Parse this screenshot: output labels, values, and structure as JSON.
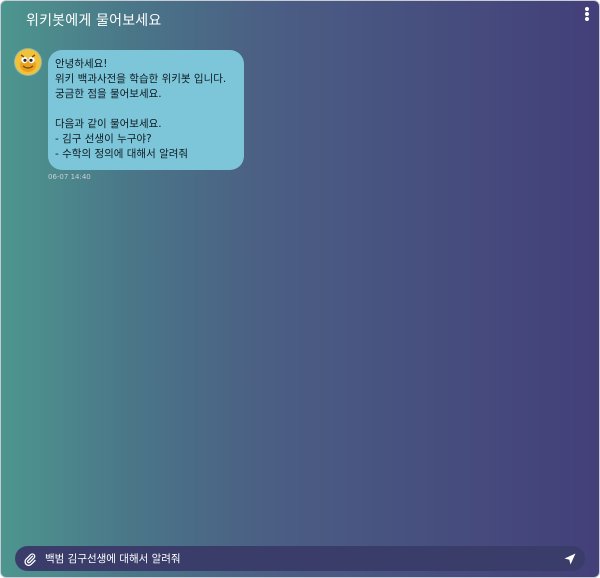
{
  "header": {
    "title": "위키봇에게 물어보세요"
  },
  "conversation": {
    "messages": [
      {
        "sender_avatar": "bot-avatar-icon",
        "lines": [
          "안녕하세요!",
          "위키 백과사전을 학습한 위키봇 입니다.",
          "궁금한 점을 물어보세요.",
          "",
          "다음과 같이 물어보세요.",
          "- 김구 선생이 누구야?",
          "- 수학의 정의에 대해서 알려줘"
        ],
        "time": "06-07 14:40"
      }
    ]
  },
  "composer": {
    "value": "백범 김구선생에 대해서 알려줘",
    "attach_icon": "paperclip-icon",
    "send_icon": "send-icon"
  },
  "colors": {
    "bubble": "#7dc6d9",
    "input_bar": "#3a3d6a",
    "gradient_start": "#4d968f",
    "gradient_end": "#433f79"
  }
}
